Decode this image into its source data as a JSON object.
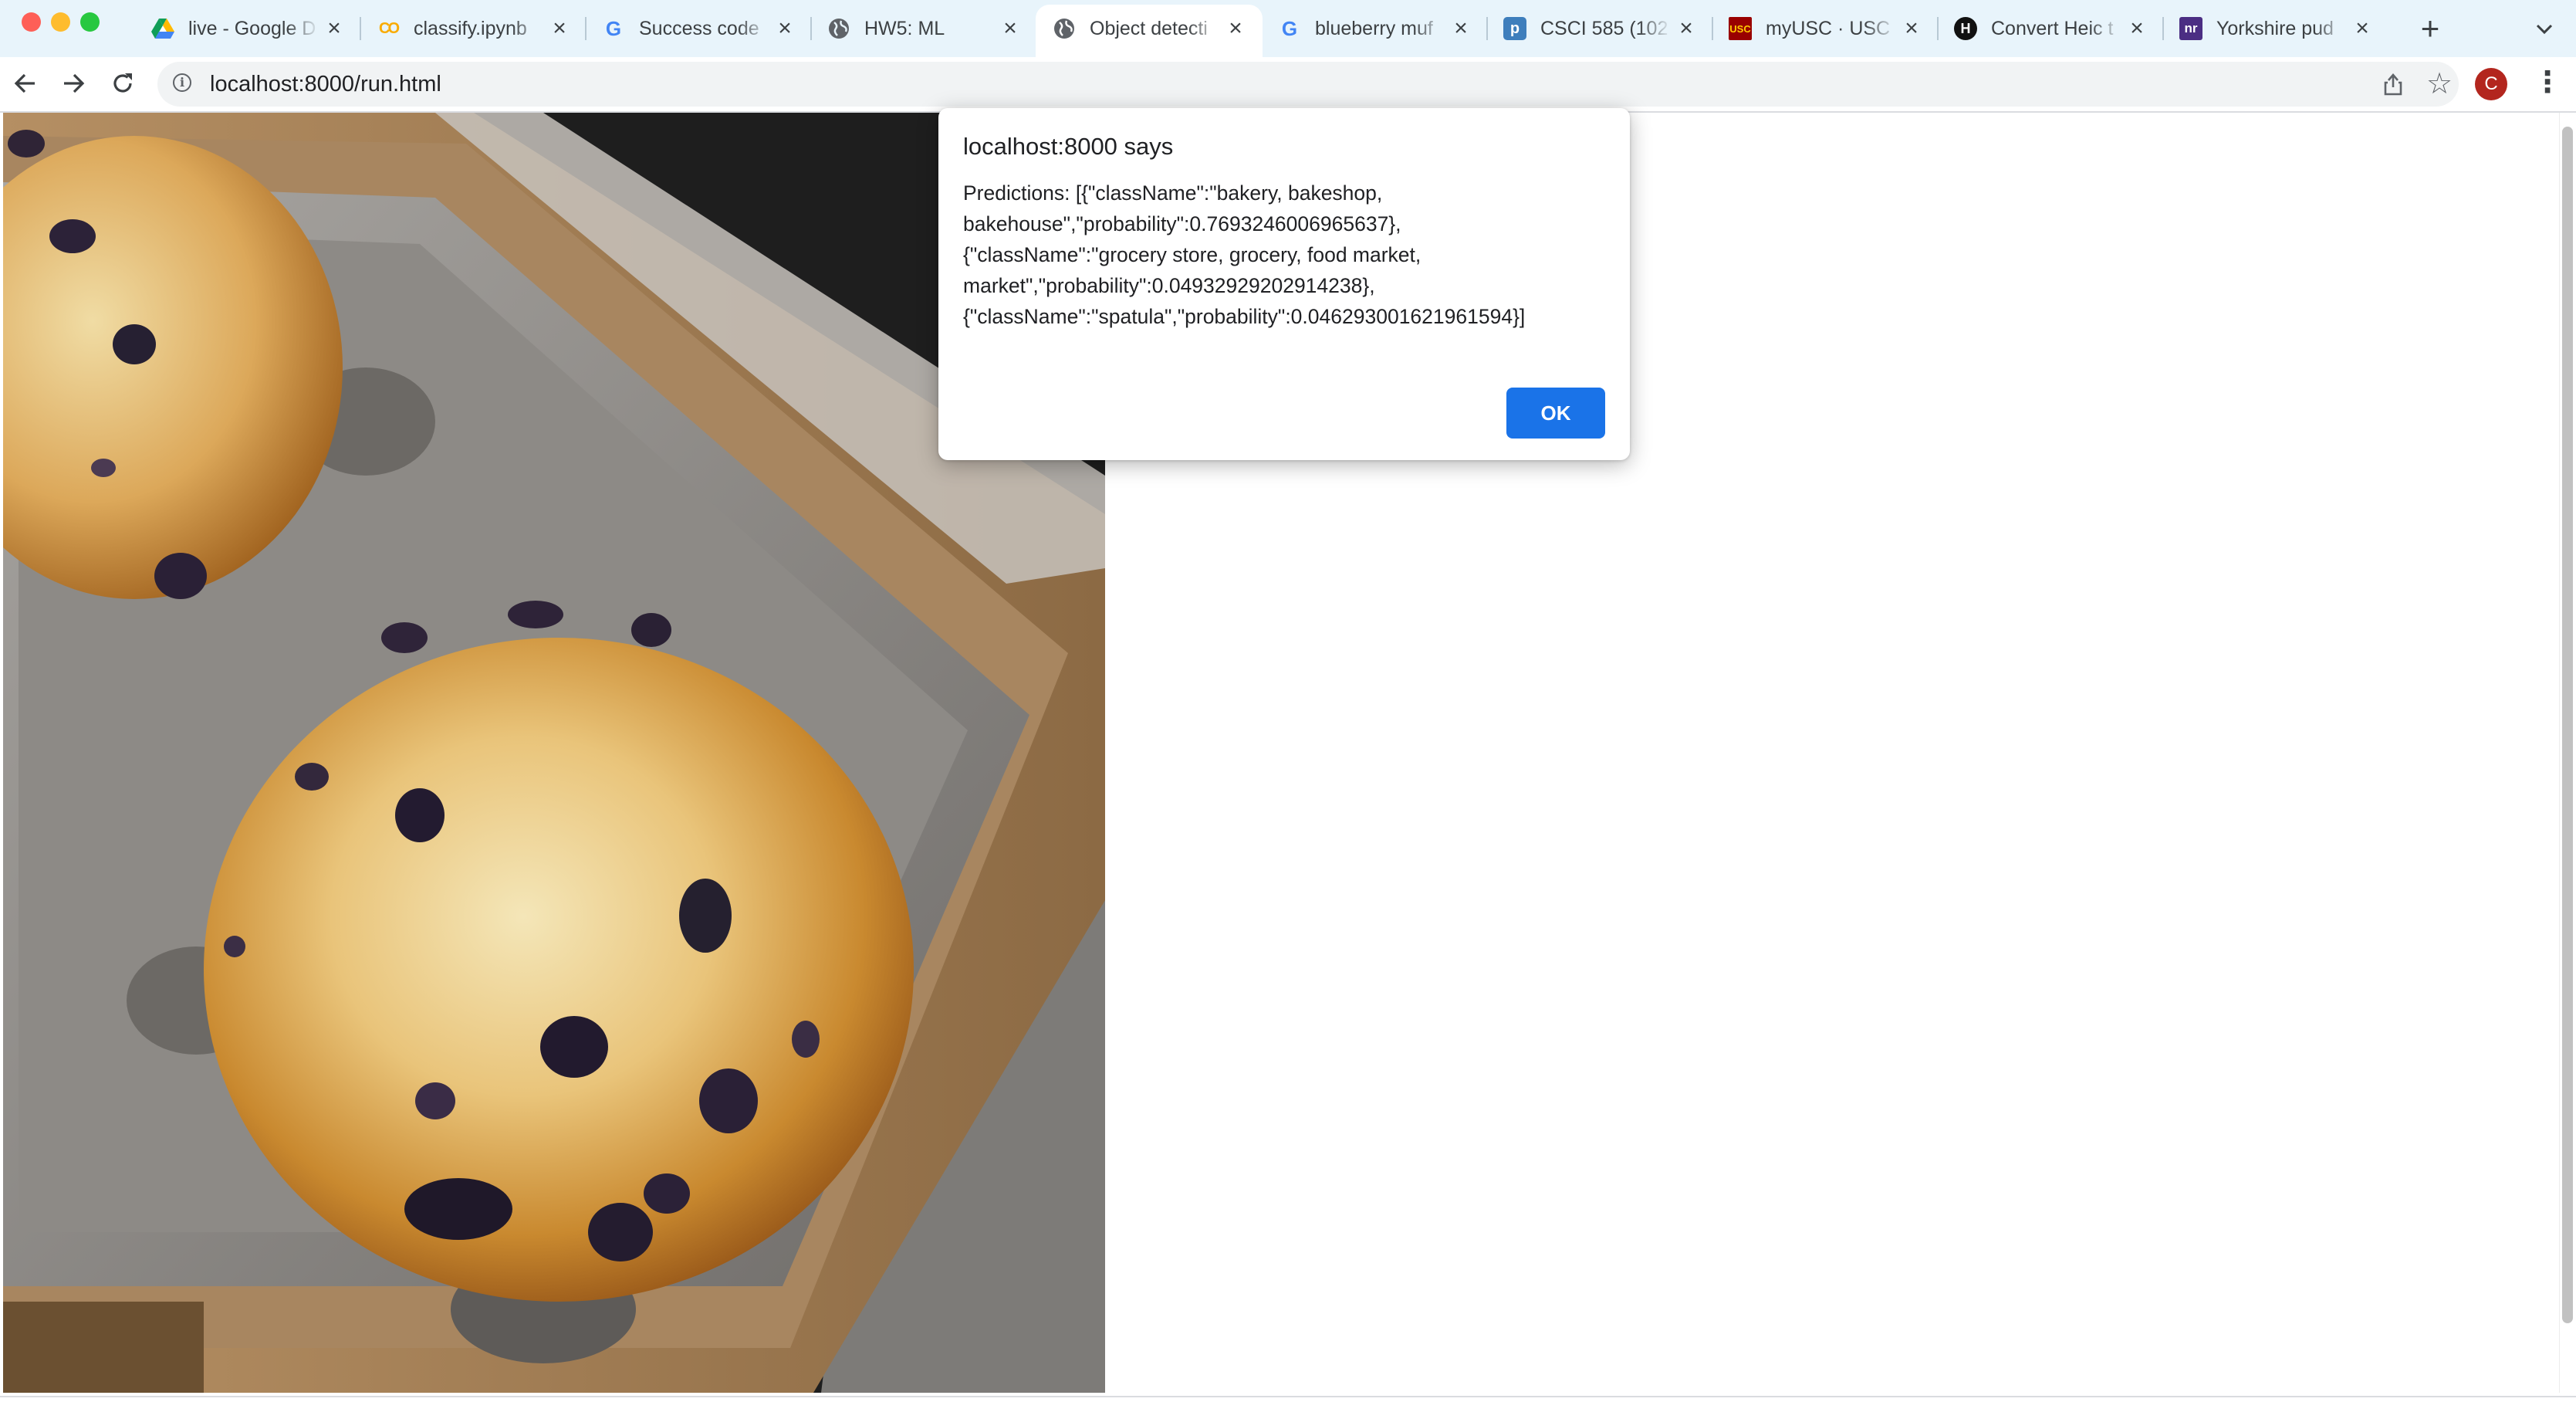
{
  "window": {
    "controls": [
      "close",
      "minimize",
      "maximize"
    ]
  },
  "tabs": [
    {
      "title": "live - Google D",
      "icon": "google-drive-icon",
      "active": false
    },
    {
      "title": "classify.ipynb",
      "icon": "colab-icon",
      "active": false
    },
    {
      "title": "Success code",
      "icon": "google-icon",
      "active": false
    },
    {
      "title": "HW5: ML",
      "icon": "globe-icon",
      "active": false
    },
    {
      "title": "Object detecti",
      "icon": "globe-icon",
      "active": true
    },
    {
      "title": "blueberry muf",
      "icon": "google-icon",
      "active": false
    },
    {
      "title": "CSCI 585 (102",
      "icon": "piazza-icon",
      "active": false
    },
    {
      "title": "myUSC · USC",
      "icon": "usc-icon",
      "active": false
    },
    {
      "title": "Convert Heic t",
      "icon": "h-icon",
      "active": false
    },
    {
      "title": "Yorkshire pud",
      "icon": "nr-icon",
      "active": false
    }
  ],
  "toolbar": {
    "url": "localhost:8000/run.html",
    "avatar_letter": "C"
  },
  "colors": {
    "tabstrip_bg": "#e8f4fb",
    "accent_blue": "#1a73e8",
    "avatar": "#b3261e"
  },
  "content": {
    "image": "blueberry muffin photo"
  },
  "dialog": {
    "title": "localhost:8000 says",
    "message": "Predictions: [{\"className\":\"bakery, bakeshop, bakehouse\",\"probability\":0.7693246006965637},{\"className\":\"grocery store, grocery, food market, market\",\"probability\":0.04932929202914238},{\"className\":\"spatula\",\"probability\":0.046293001621961594}]",
    "ok_label": "OK"
  }
}
